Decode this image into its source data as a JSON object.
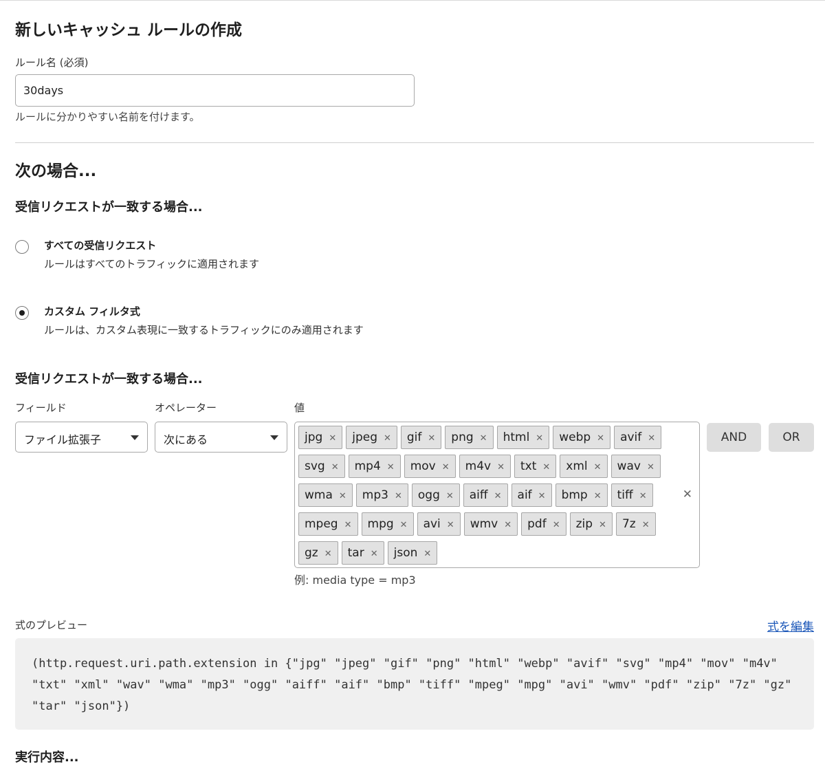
{
  "header": {
    "title": "新しいキャッシュ ルールの作成"
  },
  "rule_name": {
    "label": "ルール名 (必須)",
    "value": "30days",
    "help": "ルールに分かりやすい名前を付けます。"
  },
  "when": {
    "title": "次の場合...",
    "subtitle": "受信リクエストが一致する場合...",
    "options": [
      {
        "title": "すべての受信リクエスト",
        "desc": "ルールはすべてのトラフィックに適用されます",
        "selected": false
      },
      {
        "title": "カスタム フィルタ式",
        "desc": "ルールは、カスタム表現に一致するトラフィックにのみ適用されます",
        "selected": true
      }
    ]
  },
  "filter": {
    "subtitle": "受信リクエストが一致する場合...",
    "field_label": "フィールド",
    "field_value": "ファイル拡張子",
    "operator_label": "オペレーター",
    "operator_value": "次にある",
    "value_label": "値",
    "values": [
      "jpg",
      "jpeg",
      "gif",
      "png",
      "html",
      "webp",
      "avif",
      "svg",
      "mp4",
      "mov",
      "m4v",
      "txt",
      "xml",
      "wav",
      "wma",
      "mp3",
      "ogg",
      "aiff",
      "aif",
      "bmp",
      "tiff",
      "mpeg",
      "mpg",
      "avi",
      "wmv",
      "pdf",
      "zip",
      "7z",
      "gz",
      "tar",
      "json"
    ],
    "value_hint": "例: media type = mp3",
    "and_label": "AND",
    "or_label": "OR"
  },
  "preview": {
    "label": "式のプレビュー",
    "edit_link": "式を編集",
    "expression": "(http.request.uri.path.extension in {\"jpg\" \"jpeg\" \"gif\" \"png\" \"html\" \"webp\" \"avif\" \"svg\" \"mp4\" \"mov\" \"m4v\" \"txt\" \"xml\" \"wav\" \"wma\" \"mp3\" \"ogg\" \"aiff\" \"aif\" \"bmp\" \"tiff\" \"mpeg\" \"mpg\" \"avi\" \"wmv\" \"pdf\" \"zip\" \"7z\" \"gz\" \"tar\" \"json\"})"
  },
  "then": {
    "title": "実行内容..."
  }
}
